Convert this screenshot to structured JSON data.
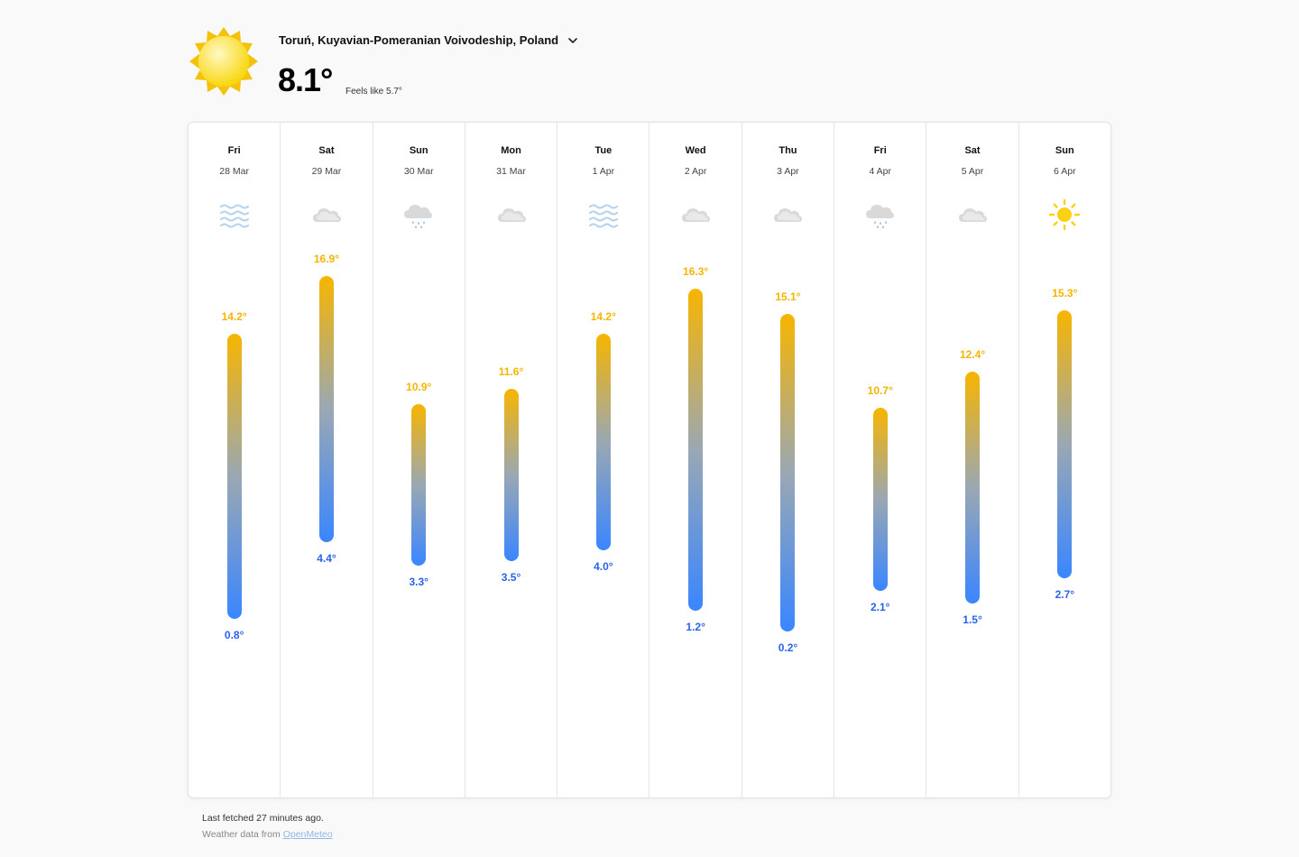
{
  "header": {
    "location": "Toruń, Kuyavian-Pomeranian Voivodeship, Poland",
    "current_temp": "8.1°",
    "feels_like": "Feels like 5.7°",
    "current_icon": "sun-icon"
  },
  "chart_data": {
    "type": "bar",
    "unit": "°",
    "categories": [
      "Fri 28 Mar",
      "Sat 29 Mar",
      "Sun 30 Mar",
      "Mon 31 Mar",
      "Tue 1 Apr",
      "Wed 2 Apr",
      "Thu 3 Apr",
      "Fri 4 Apr",
      "Sat 5 Apr",
      "Sun 6 Apr"
    ],
    "series": [
      {
        "values": [
          14.2,
          16.9,
          10.9,
          11.6,
          14.2,
          16.3,
          15.1,
          10.7,
          12.4,
          15.3
        ]
      },
      {
        "values": [
          0.8,
          4.4,
          3.3,
          3.5,
          4.0,
          1.2,
          0.2,
          2.1,
          1.5,
          2.7
        ]
      }
    ]
  },
  "forecast": [
    {
      "dow": "Fri",
      "date": "28 Mar",
      "icon": "fog-icon",
      "high": 14.2,
      "low": 0.8,
      "high_label": "14.2°",
      "low_label": "0.8°"
    },
    {
      "dow": "Sat",
      "date": "29 Mar",
      "icon": "cloud-icon",
      "high": 16.9,
      "low": 4.4,
      "high_label": "16.9°",
      "low_label": "4.4°"
    },
    {
      "dow": "Sun",
      "date": "30 Mar",
      "icon": "rain-cloud-icon",
      "high": 10.9,
      "low": 3.3,
      "high_label": "10.9°",
      "low_label": "3.3°"
    },
    {
      "dow": "Mon",
      "date": "31 Mar",
      "icon": "cloud-icon",
      "high": 11.6,
      "low": 3.5,
      "high_label": "11.6°",
      "low_label": "3.5°"
    },
    {
      "dow": "Tue",
      "date": "1 Apr",
      "icon": "fog-icon",
      "high": 14.2,
      "low": 4.0,
      "high_label": "14.2°",
      "low_label": "4.0°"
    },
    {
      "dow": "Wed",
      "date": "2 Apr",
      "icon": "cloud-icon",
      "high": 16.3,
      "low": 1.2,
      "high_label": "16.3°",
      "low_label": "1.2°"
    },
    {
      "dow": "Thu",
      "date": "3 Apr",
      "icon": "cloud-icon",
      "high": 15.1,
      "low": 0.2,
      "high_label": "15.1°",
      "low_label": "0.2°"
    },
    {
      "dow": "Fri",
      "date": "4 Apr",
      "icon": "rain-cloud-icon",
      "high": 10.7,
      "low": 2.1,
      "high_label": "10.7°",
      "low_label": "2.1°"
    },
    {
      "dow": "Sat",
      "date": "5 Apr",
      "icon": "cloud-icon",
      "high": 12.4,
      "low": 1.5,
      "high_label": "12.4°",
      "low_label": "1.5°"
    },
    {
      "dow": "Sun",
      "date": "6 Apr",
      "icon": "sun-icon",
      "high": 15.3,
      "low": 2.7,
      "high_label": "15.3°",
      "low_label": "2.7°"
    }
  ],
  "colors": {
    "high": "#f5b400",
    "low": "#2b63e8",
    "sun": "#fbd116",
    "cloud": "#d9d9d9",
    "fog": "#b9d4ef",
    "rain": "#4a90e2"
  },
  "footer": {
    "fetched": "Last fetched 27 minutes ago.",
    "source_prefix": "Weather data from",
    "source_link": "OpenMeteo"
  }
}
